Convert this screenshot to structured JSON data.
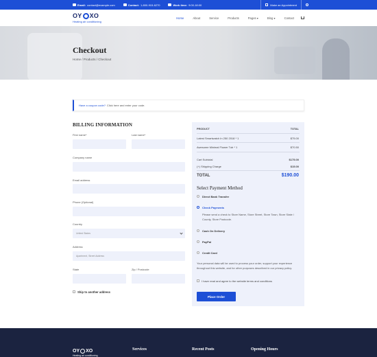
{
  "topbar": {
    "email_label": "Email:",
    "email_value": "contact@example.com",
    "contact_label": "Contact:",
    "contact_value": "1-800-915-6270",
    "worktime_label": "Work time:",
    "worktime_value": "9:00-18:00",
    "appointment": "Make an Appointment"
  },
  "logo": {
    "brand_left": "OY",
    "brand_right": "XO",
    "tagline": "Heating air conditioning"
  },
  "nav": {
    "items": [
      "Home",
      "About",
      "Service",
      "Products",
      "Pages ▾",
      "Blog ▾",
      "Contact"
    ],
    "active_index": 0
  },
  "hero": {
    "title": "Checkout",
    "breadcrumb": "Home / Products / Checkout"
  },
  "coupon": {
    "link": "Have a coupon code?",
    "text": "Click here and enter your code."
  },
  "billing": {
    "title": "BILLING INFORMATION",
    "first_name": "First name*",
    "last_name": "Last name*",
    "company": "Company name",
    "email": "Email address",
    "phone": "Phone (Optional)",
    "country": "Country",
    "country_value": "United States",
    "address": "Address",
    "address_placeholder": "Apartment, Street Address",
    "state": "State",
    "zip": "Zip / Postcode",
    "ship_other": "Ship to another address"
  },
  "order": {
    "col_product": "PRODUCT",
    "col_total": "TOTAL",
    "items": [
      {
        "name": "Latest Smartwatch In 250 2018 * 1",
        "total": "$75.00"
      },
      {
        "name": "Awesome Minimal Flower Tub * 1",
        "total": "$70.50"
      }
    ],
    "cart_subtotal_label": "Cart Subtotal",
    "cart_subtotal": "$175.00",
    "shipping_label": "(+) Shipping Charge",
    "shipping": "$15.00",
    "total_label": "TOTAL",
    "total": "$190.00",
    "payment_title": "Select Payment Method",
    "methods": [
      "Direct Bank Transfer",
      "Check Payments",
      "Cash On Delivery",
      "PayPal",
      "Credit Card"
    ],
    "selected_method": "Check Payments",
    "check_desc": "Please send a check to Store Name, Store Street, Store Town, Store State / County, Store Postcode.",
    "privacy": "Your personal data will be used to process your order, support your experience throughout this website, and for other purposes described in our privacy policy.",
    "terms": "I have read and agree to the website terms and conditions",
    "place_order": "Place Order"
  },
  "footer": {
    "services": "Services",
    "recent_posts": "Recent Posts",
    "opening_hours": "Opening Hours"
  },
  "colors": {
    "primary": "#1d4fd6",
    "footer_bg": "#1b2340",
    "field_bg": "#eef1fb"
  }
}
